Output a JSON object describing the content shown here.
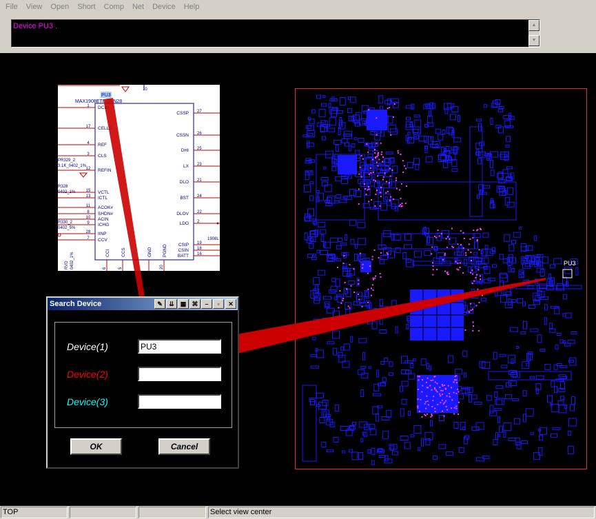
{
  "menu": [
    "File",
    "View",
    "Open",
    "Short",
    "Comp",
    "Net",
    "Device",
    "Help"
  ],
  "message": "Device PU3 .",
  "colors": {
    "chrome": "#d4d0c8",
    "message_text": "#ff00ff",
    "board_outline": "#e03030",
    "component": "#1a1aff",
    "pin": "#ff44ff",
    "pointer": "#cc0000",
    "device1": "#ffffff",
    "device2": "#ff0000",
    "device3": "#00ffff"
  },
  "schematic": {
    "ref": "PU3",
    "part": "MAX1908ETI_QFN28",
    "left_pins": [
      {
        "num": "1",
        "name": "DCIN"
      },
      {
        "num": "17",
        "name": "CELLS"
      },
      {
        "num": "4",
        "name": "REF"
      },
      {
        "num": "3",
        "name": "CLS"
      },
      {
        "num": "12",
        "name": "REFIN"
      },
      {
        "num": "15",
        "name": "VCTL"
      },
      {
        "num": "13",
        "name": "ICTL"
      },
      {
        "num": "11",
        "name": "ACOK#"
      },
      {
        "num": "8",
        "name": "SHDN#"
      },
      {
        "num": "10",
        "name": "ACIN"
      },
      {
        "num": "9",
        "name": "ICHG"
      },
      {
        "num": "28",
        "name": "IINP"
      },
      {
        "num": "7",
        "name": "CCV"
      }
    ],
    "right_pins": [
      {
        "num": "27",
        "name": "CSSP"
      },
      {
        "num": "26",
        "name": "CSSN"
      },
      {
        "num": "25",
        "name": "DHI"
      },
      {
        "num": "23",
        "name": "LX"
      },
      {
        "num": "21",
        "name": "DLO"
      },
      {
        "num": "24",
        "name": "BST"
      },
      {
        "num": "22",
        "name": "DLOV"
      },
      {
        "num": "2",
        "name": "LDO"
      },
      {
        "num": "19",
        "name": "CSIP"
      },
      {
        "num": "18",
        "name": "CSIN"
      },
      {
        "num": "16",
        "name": "BATT"
      }
    ],
    "bottom_pins": [
      {
        "num": "6",
        "name": "CCI"
      },
      {
        "num": "5",
        "name": "CCS"
      },
      {
        "num": "",
        "name": "GND"
      },
      {
        "num": "20",
        "name": "PGND"
      }
    ],
    "side_labels": [
      "PR329_2",
      "3.1K_0402_1%",
      "R328",
      "0402_1%",
      "R330_2",
      "0402_5%",
      "RVD",
      "0402_1%",
      "10",
      "1908L"
    ]
  },
  "board": {
    "highlight_label": "PU3"
  },
  "dialog": {
    "title": "Search Device",
    "title_icons": [
      "wrench-icon",
      "double-down-icon",
      "grid-icon",
      "link-icon",
      "minimize-icon",
      "restore-icon",
      "close-icon"
    ],
    "fields": [
      {
        "label": "Device(1)",
        "value": "PU3"
      },
      {
        "label": "Device(2)",
        "value": ""
      },
      {
        "label": "Device(3)",
        "value": ""
      }
    ],
    "ok_label": "OK",
    "cancel_label": "Cancel"
  },
  "status": {
    "layer": "TOP",
    "cell2": "",
    "cell3": "",
    "hint": "Select view center"
  }
}
